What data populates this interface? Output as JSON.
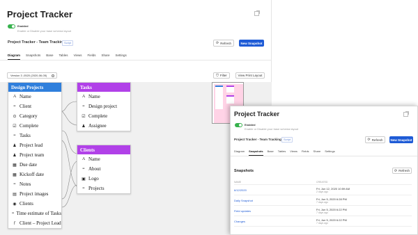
{
  "main": {
    "title": "Project Tracker",
    "enabled_label": "Enabled",
    "enabled_desc": "Enable or Disable your base schema layout",
    "project_name": "Project Tracker - Team Tracking",
    "badge": "Script",
    "refresh_label": "Refresh",
    "new_snapshot_label": "New Snapshot",
    "tabs": [
      "Diagram",
      "Snapshots",
      "Base",
      "Tables",
      "Views",
      "Fields",
      "Share",
      "Settings"
    ],
    "version_value": "Version 3 -0520 (2020-06-05)",
    "filter_label": "Filter",
    "view_print_label": "View Print Layout"
  },
  "diagram": {
    "tables": [
      {
        "name": "Design Projects",
        "color": "#2f7fdc",
        "fields": [
          {
            "icon": "text-icon",
            "glyph": "A",
            "label": "Name"
          },
          {
            "icon": "long-text-icon",
            "glyph": "≡",
            "label": "Client"
          },
          {
            "icon": "single-select-icon",
            "glyph": "⊙",
            "label": "Category"
          },
          {
            "icon": "checkbox-icon",
            "glyph": "☑",
            "label": "Complete"
          },
          {
            "icon": "long-text-icon",
            "glyph": "≡",
            "label": "Tasks"
          },
          {
            "icon": "user-icon",
            "glyph": "♟",
            "label": "Project lead"
          },
          {
            "icon": "user-icon",
            "glyph": "♟",
            "label": "Project team"
          },
          {
            "icon": "calendar-icon",
            "glyph": "▦",
            "label": "Due date"
          },
          {
            "icon": "calendar-icon",
            "glyph": "▦",
            "label": "Kickoff date"
          },
          {
            "icon": "long-text-icon",
            "glyph": "≡",
            "label": "Notes"
          },
          {
            "icon": "attachment-icon",
            "glyph": "▤",
            "label": "Project images"
          },
          {
            "icon": "lookup-icon",
            "glyph": "◉",
            "label": "Clients"
          },
          {
            "icon": "long-text-icon",
            "glyph": "≡",
            "label": "Time estimate of Tasks"
          },
          {
            "icon": "formula-icon",
            "glyph": "ƒ",
            "label": "Client – Project Lead"
          }
        ]
      },
      {
        "name": "Tasks",
        "color": "#b141e8",
        "fields": [
          {
            "icon": "text-icon",
            "glyph": "A",
            "label": "Name"
          },
          {
            "icon": "long-text-icon",
            "glyph": "≡",
            "label": "Design project"
          },
          {
            "icon": "checkbox-icon",
            "glyph": "☑",
            "label": "Complete"
          },
          {
            "icon": "user-icon",
            "glyph": "♟",
            "label": "Assignee"
          }
        ]
      },
      {
        "name": "Clients",
        "color": "#b141e8",
        "fields": [
          {
            "icon": "text-icon",
            "glyph": "A",
            "label": "Name"
          },
          {
            "icon": "long-text-icon",
            "glyph": "≡",
            "label": "About"
          },
          {
            "icon": "attachment-icon",
            "glyph": "▣",
            "label": "Logo"
          },
          {
            "icon": "long-text-icon",
            "glyph": "≡",
            "label": "Projects"
          }
        ]
      }
    ]
  },
  "snap": {
    "title": "Project Tracker",
    "enabled_label": "Enabled",
    "enabled_desc": "Enable or Disable your base schema layout",
    "project_name": "Project Tracker - Team Tracking",
    "badge": "Script",
    "refresh_label": "Refresh",
    "new_snapshot_label": "New Snapshot",
    "tabs": [
      "Diagram",
      "Snapshots",
      "Base",
      "Tables",
      "Views",
      "Fields",
      "Share",
      "Settings"
    ],
    "list_title": "Snapshots",
    "list_refresh_label": "Refresh",
    "col_name": "NAME",
    "col_created": "CREATED",
    "rows": [
      {
        "name": "6/12/2020",
        "created": "Fri, Jun 12, 2020 10:59 AM",
        "ago": "2 days ago"
      },
      {
        "name": "Daily Snapshot",
        "created": "Fri, Jun 5, 2020 6:28 PM",
        "ago": "7 days ago"
      },
      {
        "name": "Field updates",
        "created": "Fri, Jun 5, 2020 6:22 PM",
        "ago": "7 days ago"
      },
      {
        "name": "Changes",
        "created": "Fri, Jun 5, 2020 6:22 PM",
        "ago": "7 days ago"
      }
    ]
  },
  "colors": {
    "accent": "#1e5bd6",
    "enabled": "#37b24d",
    "table_blue": "#2f7fdc",
    "table_purple": "#b141e8",
    "minimap_view": "#ffd3e6"
  }
}
